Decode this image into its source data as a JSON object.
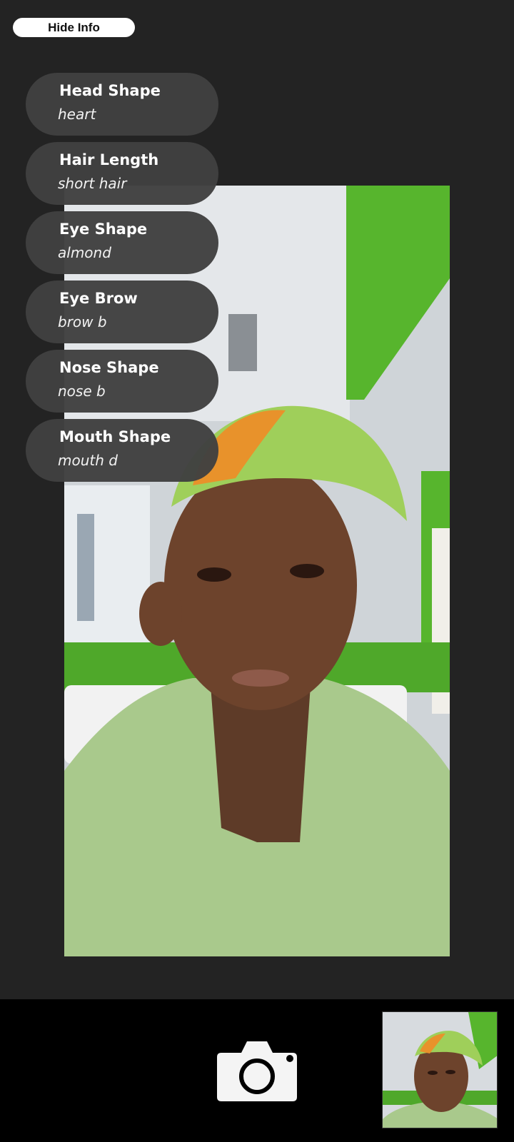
{
  "hide_info_label": "Hide Info",
  "info_items": [
    {
      "title": "Head Shape",
      "value": "heart"
    },
    {
      "title": "Hair Length",
      "value": "short hair"
    },
    {
      "title": "Eye Shape",
      "value": "almond"
    },
    {
      "title": "Eye Brow",
      "value": "brow b"
    },
    {
      "title": "Nose Shape",
      "value": "nose b"
    },
    {
      "title": "Mouth Shape",
      "value": "mouth d"
    }
  ],
  "icons": {
    "shutter": "camera-icon"
  },
  "colors": {
    "background": "#232323",
    "card": "#404040",
    "bottom_bar": "#000000",
    "accent_green": "#57b52d"
  }
}
